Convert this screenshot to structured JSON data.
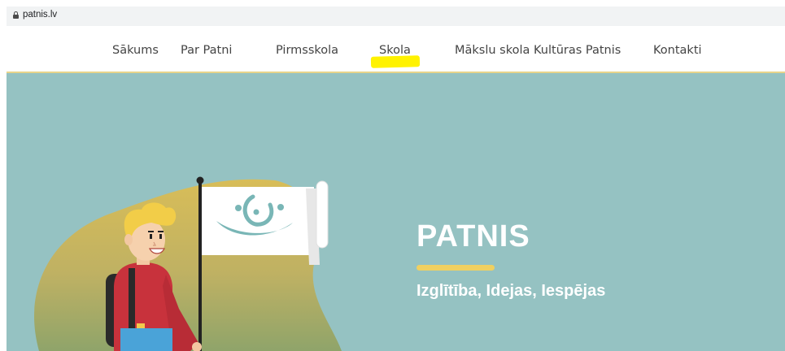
{
  "browser": {
    "url": "patnis.lv"
  },
  "nav": {
    "items": [
      {
        "label": "Sākums"
      },
      {
        "label": "Par Patni"
      },
      {
        "label": "Pirmsskola"
      },
      {
        "label": "Skola"
      },
      {
        "label": "Mākslu skola Kultūras Patnis"
      },
      {
        "label": "Kontakti"
      }
    ],
    "highlighted_item": "Skola"
  },
  "hero": {
    "title": "PATNIS",
    "subtitle": "Izglītība, Idejas, Iespējas"
  },
  "colors": {
    "hero_bg": "#95c2c2",
    "accent_yellow": "#f0d060",
    "highlight": "#fff200",
    "boy_shirt": "#c8323c"
  }
}
